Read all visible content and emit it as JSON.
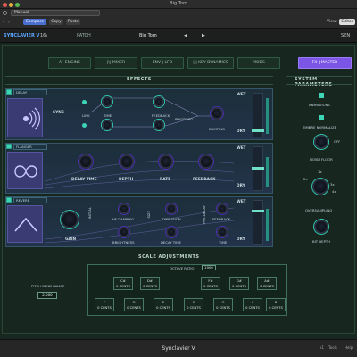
{
  "window": {
    "title": "Big Tom",
    "footer_title": "Synclavier V"
  },
  "host": {
    "preset_select": "Manual",
    "compare_label": "Compare",
    "copy_label": "Copy",
    "paste_label": "Paste",
    "view_label": "View:",
    "view_value": "Editor"
  },
  "header": {
    "product": "SYNCLAVIER V",
    "voices": "16\\",
    "mode": "PATCH",
    "preset_name": "Big Tom",
    "prev": "◀",
    "next": "▶",
    "right": "SEN"
  },
  "tabs": [
    {
      "label": "A`  ENGINE"
    },
    {
      "label": "|\\|  MIXER"
    },
    {
      "label": "ENV | LFO"
    },
    {
      "label": "|||  KEY DYNAMICS"
    },
    {
      "label": "MODS"
    },
    {
      "label": "FX | MASTER"
    }
  ],
  "effects": {
    "title": "EFFECTS",
    "panel1": {
      "tag": "DELAY",
      "sync_label": "SYNC",
      "link_label": "LINK",
      "time_label": "TIME",
      "feedback_label": "FEEDBACK",
      "pingpong_label": "PINGPONG",
      "damping_label": "DAMPING",
      "wet_label": "WET",
      "dry_label": "DRY"
    },
    "panel2": {
      "tag": "FLANGER",
      "delay_time_label": "DELAY TIME",
      "depth_label": "DEPTH",
      "rate_label": "RATE",
      "feedback_label": "FEEDBACK",
      "wet_label": "WET",
      "dry_label": "DRY"
    },
    "panel3": {
      "tag": "REVERB",
      "gain_label": "GAIN",
      "hf_damping_label": "HF DAMPING",
      "brightness_label": "BRIGHTNESS",
      "diffusion_label": "DIFFUSION",
      "decay_time_label": "DECAY TIME",
      "feedback_label": "FEEDBACK",
      "time_label": "TIME",
      "wet_label": "WET",
      "dry_label": "DRY",
      "v_labels": [
        "INITIAL",
        "SIZE",
        "PRE-DELAY"
      ]
    }
  },
  "system": {
    "title": "SYSTEM PARAMETERS",
    "animations_label": "ANIMATIONS",
    "timbre_label": "TIMBRE NORMALIZE",
    "noise_floor_label": "NOISE FLOOR",
    "noise_off": "OFF",
    "oversampling_label": "OVERSAMPLING",
    "oversampling_opts": [
      "2x",
      "1x",
      "3x",
      "4x"
    ],
    "bit_depth_label": "BIT DEPTH"
  },
  "scale": {
    "title": "SCALE ADJUSTMENTS",
    "octave_ratio_label": "OCTAVE RATIO",
    "octave_ratio_value": "1000",
    "pitch_bend_label": "PITCH BEND RANGE",
    "pitch_bend_value": "2.000",
    "black_keys": [
      {
        "note": "C#",
        "cents": "0 CENTS"
      },
      {
        "note": "D#",
        "cents": "0 CENTS"
      },
      {
        "note": "F#",
        "cents": "0 CENTS"
      },
      {
        "note": "G#",
        "cents": "0 CENTS"
      },
      {
        "note": "A#",
        "cents": "0 CENTS"
      }
    ],
    "white_keys": [
      {
        "note": "C",
        "cents": "0 CENTS"
      },
      {
        "note": "D",
        "cents": "0 CENTS"
      },
      {
        "note": "E",
        "cents": "0 CENTS"
      },
      {
        "note": "F",
        "cents": "0 CENTS"
      },
      {
        "note": "G",
        "cents": "0 CENTS"
      },
      {
        "note": "A",
        "cents": "0 CENTS"
      },
      {
        "note": "B",
        "cents": "0 CENTS"
      }
    ]
  },
  "bottom": {
    "b1": "x1",
    "b2": "Tools",
    "b3": "Help"
  },
  "colors": {
    "accent_purple": "#7a55e6",
    "accent_teal": "#3ed4b6",
    "panel_bg": "#16281f"
  }
}
